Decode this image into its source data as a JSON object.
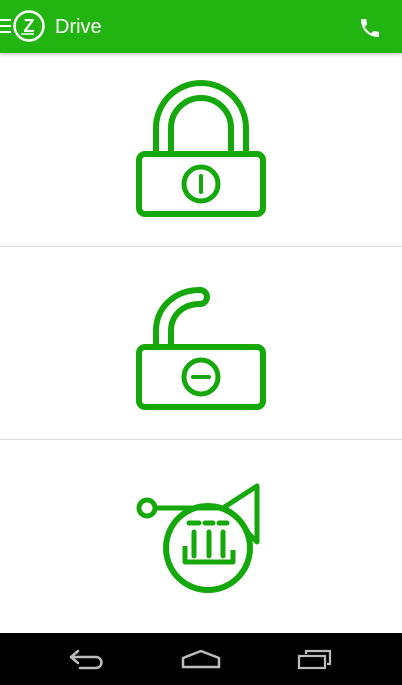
{
  "app_bar": {
    "title": "Drive",
    "menu_icon": "hamburger-icon",
    "logo_icon": "zipcar-z-logo-icon",
    "logo_letter": "Z",
    "action_icon": "phone-icon"
  },
  "actions": [
    {
      "id": "lock",
      "icon": "locked-padlock-icon"
    },
    {
      "id": "unlock",
      "icon": "unlocked-padlock-icon"
    },
    {
      "id": "horn",
      "icon": "horn-icon"
    }
  ],
  "nav_bar": {
    "back_icon": "back-arrow-icon",
    "home_icon": "home-icon",
    "recents_icon": "recent-apps-icon"
  },
  "colors": {
    "brand_green": "#22b512",
    "icon_green": "#14a80a",
    "nav_bar": "#000000",
    "nav_icon": "#bdbdbd",
    "divider": "#dcdcdc"
  }
}
